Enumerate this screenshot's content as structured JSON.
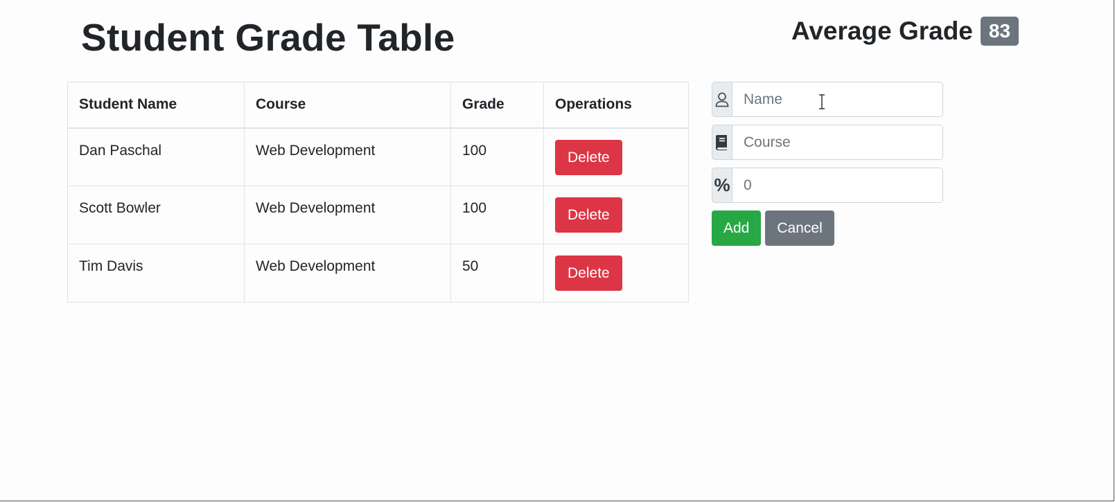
{
  "header": {
    "title": "Student Grade Table",
    "average_label": "Average Grade",
    "average_value": "83"
  },
  "table": {
    "columns": [
      "Student Name",
      "Course",
      "Grade",
      "Operations"
    ],
    "rows": [
      {
        "name": "Dan Paschal",
        "course": "Web Development",
        "grade": "100",
        "action": "Delete"
      },
      {
        "name": "Scott Bowler",
        "course": "Web Development",
        "grade": "100",
        "action": "Delete"
      },
      {
        "name": "Tim Davis",
        "course": "Web Development",
        "grade": "50",
        "action": "Delete"
      }
    ]
  },
  "form": {
    "name": {
      "placeholder": "Name",
      "value": "",
      "icon": "user-icon"
    },
    "course": {
      "placeholder": "Course",
      "value": "",
      "icon": "book-icon"
    },
    "grade": {
      "placeholder": "0",
      "value": "",
      "icon": "percent-icon",
      "symbol": "%"
    },
    "add_label": "Add",
    "cancel_label": "Cancel"
  },
  "colors": {
    "danger": "#dc3545",
    "success": "#28a745",
    "secondary": "#6c757d"
  }
}
